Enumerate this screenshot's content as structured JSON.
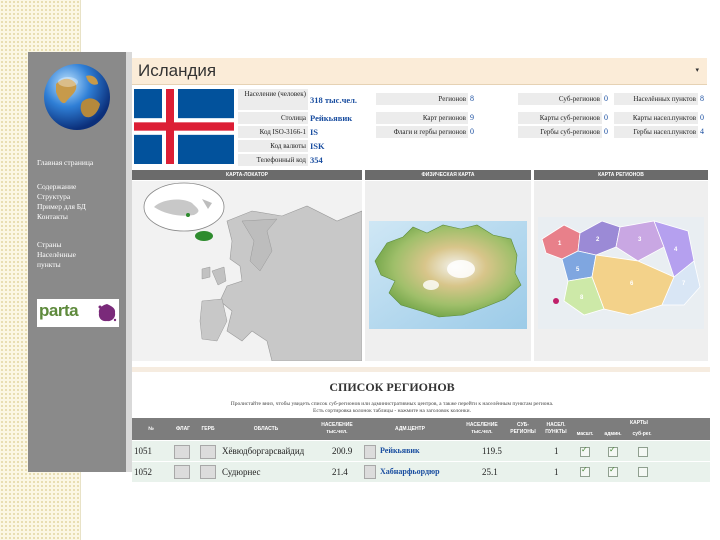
{
  "sidebar": {
    "nav": [
      {
        "label": "Главная страница"
      },
      {
        "label": "Содержание"
      },
      {
        "label": "Структура"
      },
      {
        "label": "Пример для БД"
      },
      {
        "label": "Контакты"
      },
      {
        "label": "Страны"
      },
      {
        "label": "Населённые"
      },
      {
        "label": "пункты"
      }
    ],
    "logo_text": "parta"
  },
  "country": {
    "title": "Исландия",
    "dropdown_icon": "▾",
    "info": {
      "population_label": "Население (человек)",
      "population_value": "318 тыс.чел.",
      "capital_label": "Столица",
      "capital_value": "Рейкьявик",
      "iso_label": "Код ISO-3166-1",
      "iso_value": "IS",
      "currency_label": "Код валюты",
      "currency_value": "ISK",
      "phone_label": "Телефонный код",
      "phone_value": "354"
    },
    "stats": [
      {
        "label": "Регионов",
        "value": "8"
      },
      {
        "label": "Карт регионов",
        "value": "9"
      },
      {
        "label": "Флаги и гербы регионов",
        "value": "0"
      },
      {
        "label": "Суб-регионов",
        "value": "0"
      },
      {
        "label": "Карты суб-регионов",
        "value": "0"
      },
      {
        "label": "Гербы суб-регионов",
        "value": "0"
      },
      {
        "label": "Населённых пунктов",
        "value": "8"
      },
      {
        "label": "Карты насел.пунктов",
        "value": "0"
      },
      {
        "label": "Гербы насел.пунктов",
        "value": "4"
      }
    ]
  },
  "panels": {
    "locator": "КАРТА-ЛОКАТОР",
    "physical": "ФИЗИЧЕСКАЯ КАРТА",
    "regions": "КАРТА РЕГИОНОВ"
  },
  "regions_map_labels": [
    "1",
    "2",
    "3",
    "4",
    "5",
    "6",
    "7",
    "8"
  ],
  "regions": {
    "title": "СПИСОК РЕГИОНОВ",
    "desc1": "Пролистайте вниз, чтобы увидеть список суб-регионов или административных центров, а также перейти к населённым пунктам региона.",
    "desc2": "Есть сортировка колонок таблицы - нажмите на заголовок колонки.",
    "columns": {
      "no": "№",
      "flag": "ФЛАГ",
      "coat": "ГЕРБ",
      "region": "ОБЛАСТЬ",
      "population": "НАСЕЛЕНИЕ тыс.чел.",
      "center": "АДМ.ЦЕНТР",
      "center_pop": "НАСЕЛЕНИЕ тыс.чел.",
      "subregions": "СУБ-РЕГИОНЫ",
      "settlements": "НАСЕЛ. ПУНКТЫ",
      "maps": "КАРТЫ",
      "maps_sub1": "масшт.",
      "maps_sub2": "админ.",
      "maps_sub3": "суб-рег."
    },
    "rows": [
      {
        "no": "1051",
        "region": "Хёвюдборгарсвайдид",
        "population": "200.9",
        "center": "Рейкьявик",
        "center_pop": "119.5",
        "settlements": "1"
      },
      {
        "no": "1052",
        "region": "Судюрнес",
        "population": "21.4",
        "center": "Хабнарфьордюр",
        "center_pop": "25.1",
        "settlements": "1"
      }
    ]
  },
  "colors": {
    "sidebar": "#8a8a8a",
    "titlebar": "#fbecd8",
    "flag_blue": "#02529c",
    "flag_red": "#dc1e35",
    "link": "#1a4ea0"
  }
}
